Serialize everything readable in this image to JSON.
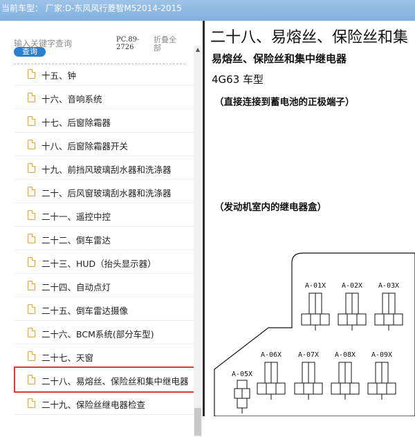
{
  "window": {
    "title": "当前车型： 厂家:D-东风风行菱智M52014-2015"
  },
  "sidebar": {
    "search_placeholder": "输入关键字查询",
    "search_button": "查询",
    "pc_number": "PC.89-2726",
    "collapse_all": "折叠全部",
    "items": [
      {
        "label": "十五、钟"
      },
      {
        "label": "十六、音响系统"
      },
      {
        "label": "十七、后窗除霜器"
      },
      {
        "label": "十八、后窗除霜器开关"
      },
      {
        "label": "十九、前挡风玻璃刮水器和洗涤器"
      },
      {
        "label": "二十、后风窗玻璃刮水器和洗涤器"
      },
      {
        "label": "二十一、遥控中控"
      },
      {
        "label": "二十二、倒车雷达"
      },
      {
        "label": "二十三、HUD（抬头显示器）"
      },
      {
        "label": "二十四、自动点灯"
      },
      {
        "label": "二十五、倒车雷达摄像"
      },
      {
        "label": "二十六、BCM系统(部分车型)"
      },
      {
        "label": "二十七、天窗"
      },
      {
        "label": "二十八、易熔丝、保险丝和集中继电器"
      },
      {
        "label": "二十九、保险丝继电器检查"
      }
    ],
    "highlight_index": 13
  },
  "content": {
    "title": "二十八、易熔丝、保险丝和集",
    "subtitle": "易熔丝、保险丝和集中继电器",
    "model": "4G63 车型",
    "note_battery": "（直接连接到蓄电池的正极端子）",
    "note_engine_box": "（发动机室内的继电器盒）",
    "relays": [
      "A-01X",
      "A-02X",
      "A-03X",
      "A-06X",
      "A-07X",
      "A-08X",
      "A-09X",
      "A-05X"
    ]
  }
}
